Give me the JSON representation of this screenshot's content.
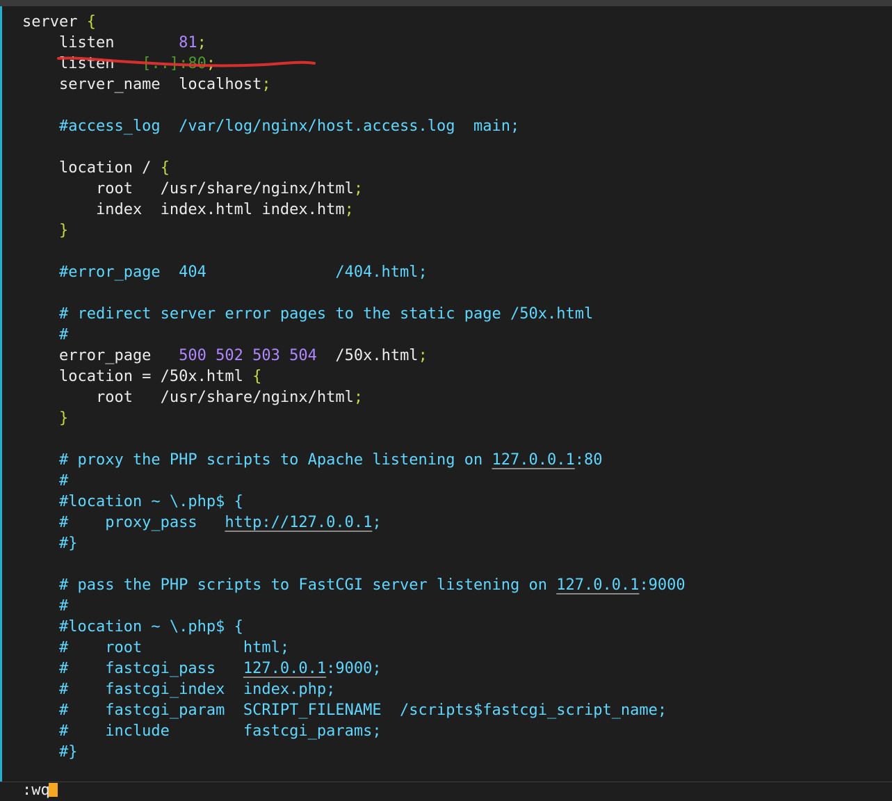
{
  "editor": {
    "lines": [
      [
        {
          "t": "server ",
          "c": "plain"
        },
        {
          "t": "{",
          "c": "punct"
        }
      ],
      [
        {
          "t": "    listen       ",
          "c": "plain"
        },
        {
          "t": "81",
          "c": "number"
        },
        {
          "t": ";",
          "c": "punct"
        }
      ],
      [
        {
          "t": "    listen  ",
          "c": "plain"
        },
        {
          "t": " [..]:80",
          "c": "dim"
        },
        {
          "t": ";",
          "c": "punct"
        }
      ],
      [
        {
          "t": "    server_name  localhost",
          "c": "plain"
        },
        {
          "t": ";",
          "c": "punct"
        }
      ],
      [],
      [
        {
          "t": "    #access_log  /var/log/nginx/host.access.log  main;",
          "c": "comment"
        }
      ],
      [],
      [
        {
          "t": "    location / ",
          "c": "plain"
        },
        {
          "t": "{",
          "c": "punct"
        }
      ],
      [
        {
          "t": "        root   /usr/share/nginx/html",
          "c": "plain"
        },
        {
          "t": ";",
          "c": "punct"
        }
      ],
      [
        {
          "t": "        index  index.html index.htm",
          "c": "plain"
        },
        {
          "t": ";",
          "c": "punct"
        }
      ],
      [
        {
          "t": "    ",
          "c": "plain"
        },
        {
          "t": "}",
          "c": "punct"
        }
      ],
      [],
      [
        {
          "t": "    #error_page  404              /404.html;",
          "c": "comment"
        }
      ],
      [],
      [
        {
          "t": "    # redirect server error pages to the static page /50x.html",
          "c": "comment"
        }
      ],
      [
        {
          "t": "    #",
          "c": "comment"
        }
      ],
      [
        {
          "t": "    error_page   ",
          "c": "plain"
        },
        {
          "t": "500 502 503 504",
          "c": "number"
        },
        {
          "t": "  /50x.html",
          "c": "plain"
        },
        {
          "t": ";",
          "c": "punct"
        }
      ],
      [
        {
          "t": "    location = /50x.html ",
          "c": "plain"
        },
        {
          "t": "{",
          "c": "punct"
        }
      ],
      [
        {
          "t": "        root   /usr/share/nginx/html",
          "c": "plain"
        },
        {
          "t": ";",
          "c": "punct"
        }
      ],
      [
        {
          "t": "    ",
          "c": "plain"
        },
        {
          "t": "}",
          "c": "punct"
        }
      ],
      [],
      [
        {
          "t": "    # proxy the PHP scripts to Apache listening on ",
          "c": "comment"
        },
        {
          "t": "127.0.0.1",
          "c": "link"
        },
        {
          "t": ":80",
          "c": "comment"
        }
      ],
      [
        {
          "t": "    #",
          "c": "comment"
        }
      ],
      [
        {
          "t": "    #location ~ \\.php$ {",
          "c": "comment"
        }
      ],
      [
        {
          "t": "    #    proxy_pass   ",
          "c": "comment"
        },
        {
          "t": "http://127.0.0.1",
          "c": "link"
        },
        {
          "t": ";",
          "c": "comment"
        }
      ],
      [
        {
          "t": "    #}",
          "c": "comment"
        }
      ],
      [],
      [
        {
          "t": "    # pass the PHP scripts to FastCGI server listening on ",
          "c": "comment"
        },
        {
          "t": "127.0.0.1",
          "c": "link"
        },
        {
          "t": ":9000",
          "c": "comment"
        }
      ],
      [
        {
          "t": "    #",
          "c": "comment"
        }
      ],
      [
        {
          "t": "    #location ~ \\.php$ {",
          "c": "comment"
        }
      ],
      [
        {
          "t": "    #    root           html;",
          "c": "comment"
        }
      ],
      [
        {
          "t": "    #    fastcgi_pass   ",
          "c": "comment"
        },
        {
          "t": "127.0.0.1",
          "c": "link"
        },
        {
          "t": ":9000;",
          "c": "comment"
        }
      ],
      [
        {
          "t": "    #    fastcgi_index  index.php;",
          "c": "comment"
        }
      ],
      [
        {
          "t": "    #    fastcgi_param  SCRIPT_FILENAME  /scripts$fastcgi_script_name;",
          "c": "comment"
        }
      ],
      [
        {
          "t": "    #    include        fastcgi_params;",
          "c": "comment"
        }
      ],
      [
        {
          "t": "    #}",
          "c": "comment"
        }
      ]
    ]
  },
  "command_line": {
    "text": ":wq"
  },
  "colors": {
    "background": "#1e1e1e",
    "gutter_accent": "#23b0d2",
    "cursor": "#f5a623",
    "annotation_stroke": "#e8322f"
  }
}
